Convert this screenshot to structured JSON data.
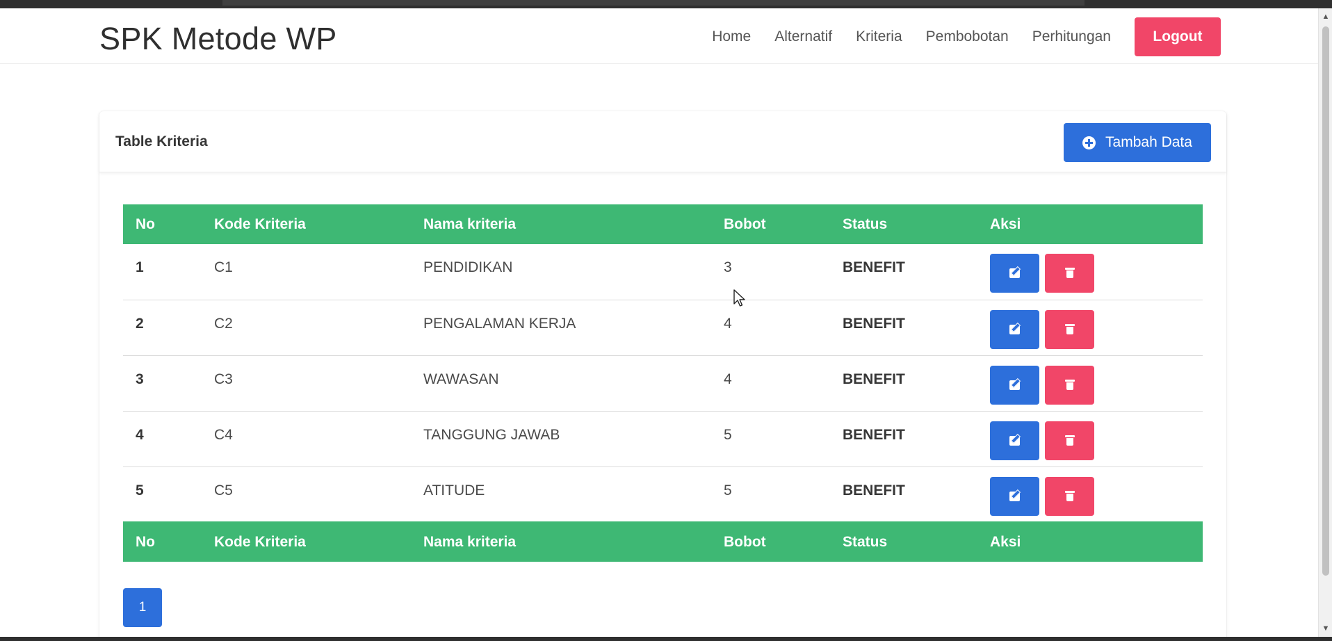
{
  "navbar": {
    "brand": "SPK Metode WP",
    "links": [
      "Home",
      "Alternatif",
      "Kriteria",
      "Pembobotan",
      "Perhitungan"
    ],
    "logout_label": "Logout"
  },
  "card": {
    "title": "Table Kriteria",
    "add_label": "Tambah Data",
    "add_icon": "plus-circle-icon"
  },
  "table": {
    "headers": [
      "No",
      "Kode Kriteria",
      "Nama kriteria",
      "Bobot",
      "Status",
      "Aksi"
    ],
    "rows": [
      {
        "no": "1",
        "kode": "C1",
        "nama": "PENDIDIKAN",
        "bobot": "3",
        "status": "BENEFIT"
      },
      {
        "no": "2",
        "kode": "C2",
        "nama": "PENGALAMAN KERJA",
        "bobot": "4",
        "status": "BENEFIT"
      },
      {
        "no": "3",
        "kode": "C3",
        "nama": "WAWASAN",
        "bobot": "4",
        "status": "BENEFIT"
      },
      {
        "no": "4",
        "kode": "C4",
        "nama": "TANGGUNG JAWAB",
        "bobot": "5",
        "status": "BENEFIT"
      },
      {
        "no": "5",
        "kode": "C5",
        "nama": "ATITUDE",
        "bobot": "5",
        "status": "BENEFIT"
      }
    ],
    "row_actions": [
      "edit-icon",
      "trash-icon"
    ]
  },
  "pagination": {
    "current": "1"
  },
  "colors": {
    "header_green": "#3eb874",
    "primary_blue": "#2d6fdb",
    "danger_red": "#f14668"
  }
}
